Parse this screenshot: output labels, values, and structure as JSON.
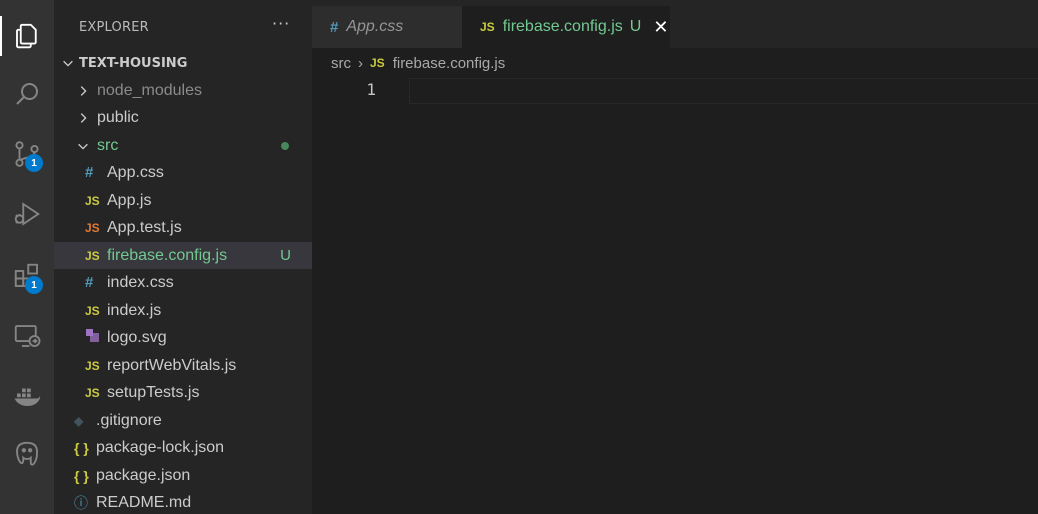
{
  "activity_bar": {
    "items": [
      {
        "icon": "files-icon",
        "active": true
      },
      {
        "icon": "search-icon"
      },
      {
        "icon": "source-control-icon",
        "badge": "1"
      },
      {
        "icon": "run-debug-icon"
      },
      {
        "icon": "extensions-icon",
        "badge": "1"
      },
      {
        "icon": "remote-explorer-icon"
      },
      {
        "icon": "docker-icon"
      },
      {
        "icon": "postgres-icon"
      }
    ]
  },
  "sidebar": {
    "title": "EXPLORER",
    "more": "···",
    "project": "TEXT-HOUSING",
    "tree": [
      {
        "label": "node_modules",
        "icon": "chevron-right-icon"
      },
      {
        "label": "public",
        "icon": "chevron-right-icon"
      },
      {
        "label": "src",
        "icon": "chevron-down-icon"
      },
      {
        "label": "App.css",
        "icon": "css-file-icon",
        "glyph": "#"
      },
      {
        "label": "App.js",
        "icon": "js-file-icon",
        "glyph": "JS"
      },
      {
        "label": "App.test.js",
        "icon": "js-test-file-icon",
        "glyph": "JS"
      },
      {
        "label": "firebase.config.js",
        "icon": "js-file-icon",
        "glyph": "JS",
        "status": "U"
      },
      {
        "label": "index.css",
        "icon": "css-file-icon",
        "glyph": "#"
      },
      {
        "label": "index.js",
        "icon": "js-file-icon",
        "glyph": "JS"
      },
      {
        "label": "logo.svg",
        "icon": "svg-file-icon"
      },
      {
        "label": "reportWebVitals.js",
        "icon": "js-file-icon",
        "glyph": "JS"
      },
      {
        "label": "setupTests.js",
        "icon": "js-file-icon",
        "glyph": "JS"
      },
      {
        "label": ".gitignore",
        "icon": "git-file-icon",
        "glyph": "◆"
      },
      {
        "label": "package-lock.json",
        "icon": "json-file-icon",
        "glyph": "{ }"
      },
      {
        "label": "package.json",
        "icon": "json-file-icon",
        "glyph": "{ }"
      },
      {
        "label": "README.md",
        "icon": "info-file-icon",
        "glyph": "ⓘ"
      }
    ]
  },
  "tabs": [
    {
      "label": "App.css",
      "glyph": "#",
      "icon": "css-file-icon"
    },
    {
      "label": "firebase.config.js",
      "glyph": "JS",
      "icon": "js-file-icon",
      "status": "U",
      "close": "✕"
    }
  ],
  "breadcrumb": {
    "folder": "src",
    "sep": "›",
    "file_glyph": "JS",
    "file": "firebase.config.js"
  },
  "editor": {
    "line_numbers": [
      "1"
    ]
  },
  "colors": {
    "untracked": "#73c991",
    "accent_badge": "#007acc",
    "js_icon": "#cbcb41",
    "css_icon": "#519aba"
  }
}
